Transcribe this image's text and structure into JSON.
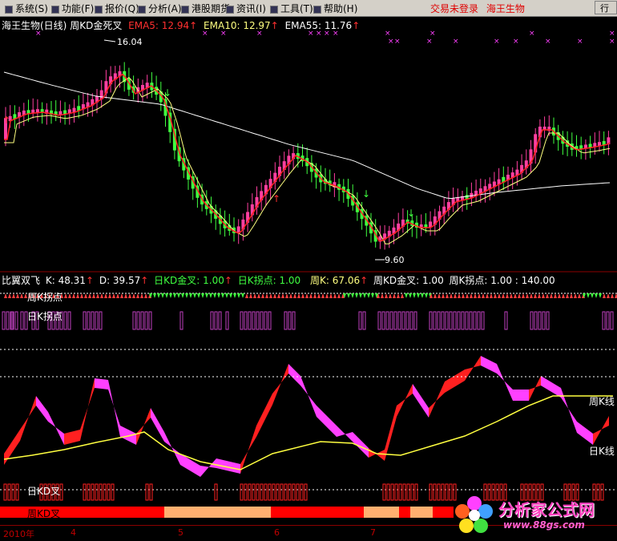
{
  "menubar": {
    "items": [
      {
        "label": "系统(S)",
        "icon": "system-icon"
      },
      {
        "label": "功能(F)",
        "icon": "function-icon"
      },
      {
        "label": "报价(Q)",
        "icon": "quote-icon"
      },
      {
        "label": "分析(A)",
        "icon": "analysis-icon"
      },
      {
        "label": "港股期货",
        "icon": "hk-futures-icon"
      },
      {
        "label": "资讯(I)",
        "icon": "info-icon"
      },
      {
        "label": "工具(T)",
        "icon": "tools-icon"
      },
      {
        "label": "帮助(H)",
        "icon": "help-icon"
      }
    ],
    "status": "交易未登录",
    "stock": "海王生物",
    "go": "行"
  },
  "main_panel": {
    "title": "海王生物(日线)",
    "indicator": "周KD金死叉",
    "ema5": "EMA5: 12.94",
    "ema10": "EMA10: 12.97",
    "ema55": "EMA55: 11.76",
    "high_label": "16.04",
    "low_label": "9.60",
    "colors": {
      "up": "#ff3fa0",
      "down": "#40ff40",
      "ema5": "#ff2020",
      "ema10": "#ffff80",
      "ema55": "#ffffff"
    }
  },
  "indicator_panel": {
    "name": "比翼双飞",
    "k": "K: 48.31",
    "d": "D: 39.57",
    "day_kd_cross": "日KD金叉: 1.00",
    "day_k_turn": "日K拐点: 1.00",
    "week_k": "周K: 67.06",
    "week_kd_cross": "周KD金叉: 1.00",
    "week_k_turn": "周K拐点: 1.00 : 140.00",
    "lbl_week_k_turn": "周K拐点",
    "lbl_day_k_turn": "日K拐点",
    "lbl_week_k_line": "周K线",
    "lbl_day_k_line": "日K线",
    "lbl_day_kd_cross": "日KD叉",
    "lbl_week_kd_cross": "周KD叉"
  },
  "time_axis": {
    "labels": [
      "2010年",
      "4",
      "5",
      "6",
      "7"
    ]
  },
  "watermark": {
    "title": "分析家公式网",
    "url": "www.88gs.com"
  },
  "chart_data": {
    "type": "candlestick",
    "price_high": 16.04,
    "price_low": 9.6,
    "ema_values": {
      "EMA5": 12.94,
      "EMA10": 12.97,
      "EMA55": 11.76
    },
    "kd_values": {
      "K": 48.31,
      "D": 39.57,
      "weekly_K": 67.06
    },
    "x_labels": [
      "2010年",
      "4",
      "5",
      "6",
      "7"
    ]
  }
}
